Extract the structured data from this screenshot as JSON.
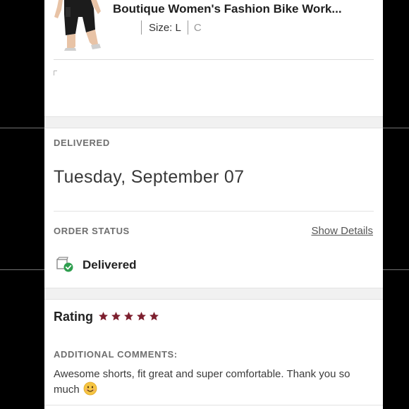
{
  "product": {
    "title": "Boutique Women's Fashion Bike Work...",
    "size_label": "Size: L",
    "color_partial": "C",
    "image_icon": "bike-shorts-product-image"
  },
  "delivered": {
    "section_label": "DELIVERED",
    "date": "Tuesday, September 07"
  },
  "order_status": {
    "section_label": "ORDER STATUS",
    "show_details_label": "Show Details",
    "status": "Delivered",
    "status_icon": "delivered-box-check-icon",
    "check_color": "#2e9e4e"
  },
  "rating": {
    "label": "Rating",
    "stars": 5,
    "max_stars": 5,
    "star_color": "#7d1f2e"
  },
  "comments": {
    "section_label": "ADDITIONAL COMMENTS:",
    "text": "Awesome shorts, fit great and super comfortable. Thank you so much",
    "emoji_icon": "smiling-face-emoji"
  }
}
